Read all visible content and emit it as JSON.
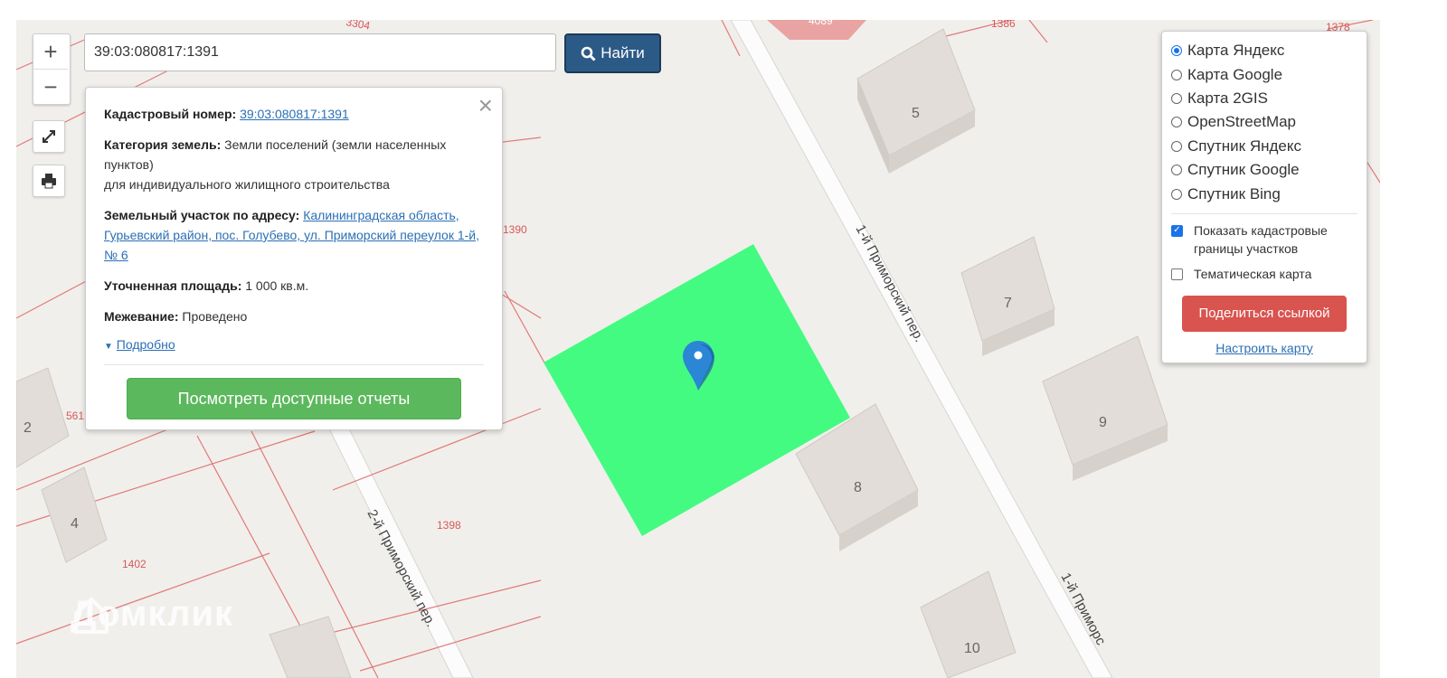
{
  "search": {
    "value": "39:03:080817:1391",
    "button_label": "Найти"
  },
  "zoom": {
    "plus": "+",
    "minus": "−"
  },
  "popup": {
    "cad_label": "Кадастровый номер:",
    "cad_value": "39:03:080817:1391",
    "category_label": "Категория земель:",
    "category_value": "Земли поселений (земли населенных пунктов)",
    "category_use": "для индивидуального жилищного строительства",
    "address_label": "Земельный участок по адресу:",
    "address_value": "Калининградская область, Гурьевский район, пос. Голубево, ул. Приморский переулок 1-й, № 6",
    "area_label": "Уточненная площадь:",
    "area_value": "1 000 кв.м.",
    "survey_label": "Межевание:",
    "survey_value": "Проведено",
    "details_link": "Подробно",
    "reports_button": "Посмотреть доступные отчеты",
    "close": "×"
  },
  "layers": {
    "options": [
      {
        "label": "Карта Яндекс",
        "selected": true
      },
      {
        "label": "Карта Google",
        "selected": false
      },
      {
        "label": "Карта 2GIS",
        "selected": false
      },
      {
        "label": "OpenStreetMap",
        "selected": false
      },
      {
        "label": "Спутник Яндекс",
        "selected": false
      },
      {
        "label": "Спутник Google",
        "selected": false
      },
      {
        "label": "Спутник Bing",
        "selected": false
      }
    ],
    "show_cadastral": "Показать кадастровые границы участков",
    "show_cadastral_checked": true,
    "thematic": "Тематическая карта",
    "thematic_checked": false,
    "share_button": "Поделиться ссылкой",
    "configure_link": "Настроить карту"
  },
  "map": {
    "street_1": "1-й Приморский пер.",
    "street_1b": "1-й Приморс",
    "street_2": "2-й Приморский пер.",
    "building_labels": [
      "5",
      "7",
      "9",
      "8",
      "10",
      "2",
      "4"
    ],
    "parcel_labels": [
      "3304",
      "1386",
      "1378",
      "4089",
      "1390",
      "1398",
      "1402",
      "561"
    ],
    "watermark": "Домклик",
    "parcel_color": "#44fb82",
    "marker_color": "#2b86d6"
  }
}
